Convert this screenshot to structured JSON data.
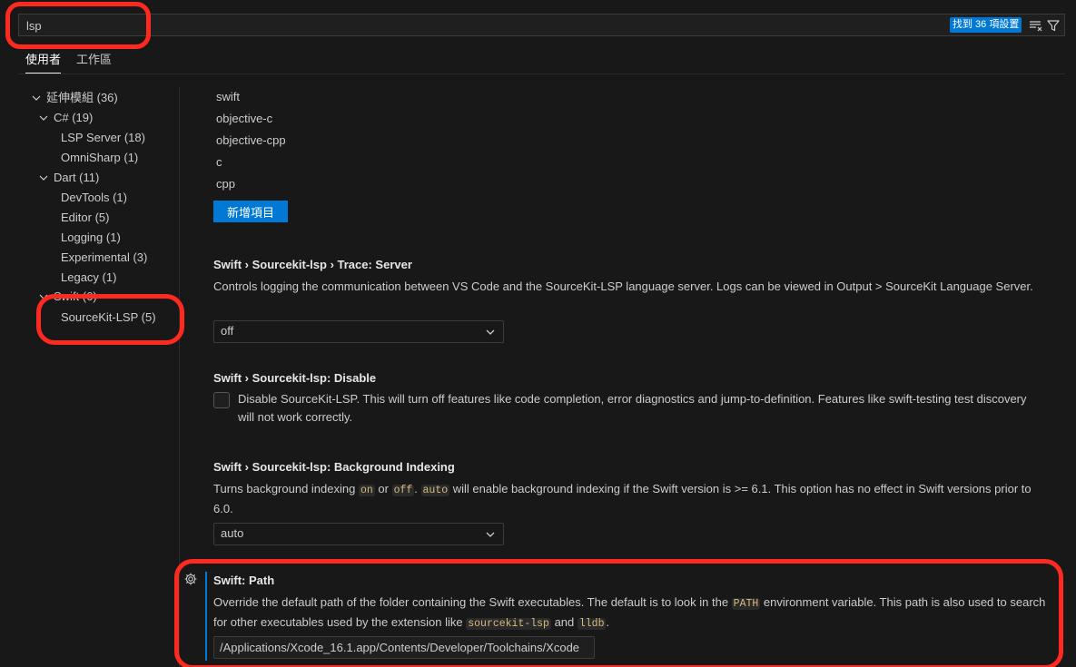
{
  "search": {
    "value": "lsp",
    "result_count": "找到 36 項設置"
  },
  "tabs": [
    {
      "label": "使用者"
    },
    {
      "label": "工作區"
    }
  ],
  "toc": {
    "extensions": "延伸模組 (36)",
    "csharp": "C# (19)",
    "lsp_server": "LSP Server (18)",
    "omnisharp": "OmniSharp (1)",
    "dart": "Dart (11)",
    "devtools": "DevTools (1)",
    "editor": "Editor (5)",
    "logging": "Logging (1)",
    "experimental": "Experimental (3)",
    "legacy": "Legacy (1)",
    "swift_partial": "Swift (6)",
    "sourcekit": "SourceKit-LSP (5)"
  },
  "languages_list": {
    "items": [
      "swift",
      "objective-c",
      "objective-cpp",
      "c",
      "cpp"
    ],
    "add_button": "新增項目"
  },
  "trace_server": {
    "category": "Swift › Sourcekit-lsp › ",
    "name": "Trace: Server",
    "description": "Controls logging the communication between VS Code and the SourceKit-LSP language server. Logs can be viewed in Output > SourceKit Language Server.",
    "value": "off"
  },
  "disable": {
    "category": "Swift › Sourcekit-lsp: ",
    "name": "Disable",
    "description": "Disable SourceKit-LSP. This will turn off features like code completion, error diagnostics and jump-to-definition. Features like swift-testing test discovery will not work correctly.",
    "checked": false
  },
  "background_indexing": {
    "category": "Swift › Sourcekit-lsp: ",
    "name": "Background Indexing",
    "desc_1": "Turns background indexing ",
    "code_on": "on",
    "desc_2": " or ",
    "code_off": "off",
    "desc_3": ". ",
    "code_auto": "auto",
    "desc_4": " will enable background indexing if the Swift version is >= 6.1. This option has no effect in Swift versions prior to 6.0.",
    "value": "auto"
  },
  "swift_path": {
    "category": "Swift: ",
    "name": "Path",
    "desc_1": "Override the default path of the folder containing the Swift executables. The default is to look in the ",
    "code_path": "PATH",
    "desc_2": " environment variable. This path is also used to search for other executables used by the extension like ",
    "code_sourcekit": "sourcekit-lsp",
    "desc_3": " and ",
    "code_lldb": "lldb",
    "desc_4": ".",
    "value": "/Applications/Xcode_16.1.app/Contents/Developer/Toolchains/Xcode"
  },
  "colors": {
    "accent": "#0078d4",
    "annotation": "#ff2a1f",
    "background": "#181818"
  }
}
